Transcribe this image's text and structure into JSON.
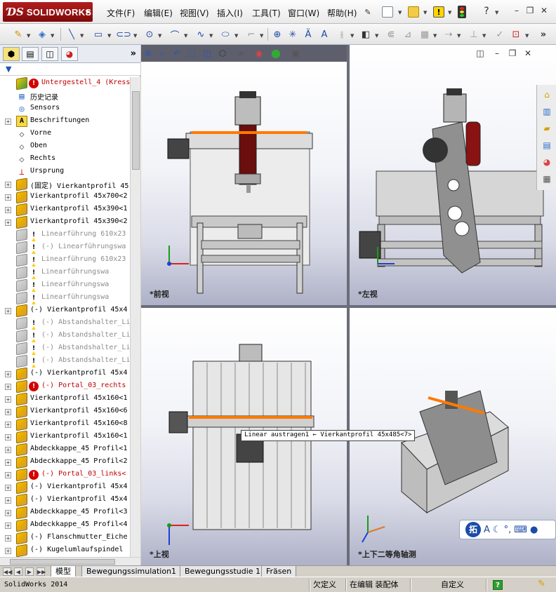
{
  "app": {
    "brand": "SOLIDWORKS"
  },
  "menu": [
    "文件(F)",
    "编辑(E)",
    "视图(V)",
    "插入(I)",
    "工具(T)",
    "窗口(W)",
    "帮助(H)"
  ],
  "tree": {
    "items": [
      {
        "label": "Untergestell_4  (Kress 1",
        "style": "red",
        "icon": "assembly",
        "exp": "",
        "badge": "error"
      },
      {
        "label": "历史记录",
        "style": "normal",
        "icon": "history",
        "exp": ""
      },
      {
        "label": "Sensors",
        "style": "normal",
        "icon": "sensor",
        "exp": ""
      },
      {
        "label": "Beschriftungen",
        "style": "normal",
        "icon": "annotation",
        "exp": "+"
      },
      {
        "label": "Vorne",
        "style": "normal",
        "icon": "plane",
        "exp": ""
      },
      {
        "label": "Oben",
        "style": "normal",
        "icon": "plane",
        "exp": ""
      },
      {
        "label": "Rechts",
        "style": "normal",
        "icon": "plane",
        "exp": ""
      },
      {
        "label": "Ursprung",
        "style": "normal",
        "icon": "origin",
        "exp": ""
      },
      {
        "label": "(固定) Vierkantprofil 45",
        "style": "normal",
        "icon": "part",
        "exp": "+"
      },
      {
        "label": "Vierkantprofil 45x700<2",
        "style": "normal",
        "icon": "part",
        "exp": "+"
      },
      {
        "label": "Vierkantprofil 45x390<1",
        "style": "normal",
        "icon": "part",
        "exp": "+"
      },
      {
        "label": "Vierkantprofil 45x390<2",
        "style": "normal",
        "icon": "part",
        "exp": "+"
      },
      {
        "label": "Linearführung 610x23",
        "style": "gray",
        "icon": "ghost",
        "exp": "",
        "badge": "warn"
      },
      {
        "label": "(-) Linearführungswa",
        "style": "gray",
        "icon": "ghost",
        "exp": "",
        "badge": "warn"
      },
      {
        "label": "Linearführung 610x23",
        "style": "gray",
        "icon": "ghost",
        "exp": "",
        "badge": "warn"
      },
      {
        "label": "Linearführungswa",
        "style": "gray",
        "icon": "ghost",
        "exp": "",
        "badge": "warn"
      },
      {
        "label": "Linearführungswa",
        "style": "gray",
        "icon": "ghost",
        "exp": "",
        "badge": "warn"
      },
      {
        "label": "Linearführungswa",
        "style": "gray",
        "icon": "ghost",
        "exp": "",
        "badge": "warn"
      },
      {
        "label": "(-) Vierkantprofil 45x4",
        "style": "normal",
        "icon": "part",
        "exp": "+"
      },
      {
        "label": "(-) Abstandshalter_Li",
        "style": "gray",
        "icon": "ghost",
        "exp": "",
        "badge": "warn"
      },
      {
        "label": "(-) Abstandshalter_Li",
        "style": "gray",
        "icon": "ghost",
        "exp": "",
        "badge": "warn"
      },
      {
        "label": "(-) Abstandshalter_Li",
        "style": "gray",
        "icon": "ghost",
        "exp": "",
        "badge": "warn"
      },
      {
        "label": "(-) Abstandshalter_Li",
        "style": "gray",
        "icon": "ghost",
        "exp": "",
        "badge": "warn"
      },
      {
        "label": "(-) Vierkantprofil 45x4",
        "style": "normal",
        "icon": "part",
        "exp": "+"
      },
      {
        "label": "(-) Portal_03_rechts",
        "style": "red",
        "icon": "part",
        "exp": "+",
        "badge": "error"
      },
      {
        "label": "Vierkantprofil 45x160<1",
        "style": "normal",
        "icon": "part",
        "exp": "+"
      },
      {
        "label": "Vierkantprofil 45x160<6",
        "style": "normal",
        "icon": "part",
        "exp": "+"
      },
      {
        "label": "Vierkantprofil 45x160<8",
        "style": "normal",
        "icon": "part",
        "exp": "+"
      },
      {
        "label": "Vierkantprofil 45x160<1",
        "style": "normal",
        "icon": "part",
        "exp": "+"
      },
      {
        "label": "Abdeckkappe_45 Profil<1",
        "style": "normal",
        "icon": "part",
        "exp": "+"
      },
      {
        "label": "Abdeckkappe_45 Profil<2",
        "style": "normal",
        "icon": "part",
        "exp": "+"
      },
      {
        "label": "(-) Portal_03_links<",
        "style": "red",
        "icon": "part",
        "exp": "+",
        "badge": "error"
      },
      {
        "label": "(-) Vierkantprofil 45x4",
        "style": "normal",
        "icon": "part",
        "exp": "+"
      },
      {
        "label": "(-) Vierkantprofil 45x4",
        "style": "normal",
        "icon": "part",
        "exp": "+"
      },
      {
        "label": "Abdeckkappe_45 Profil<3",
        "style": "normal",
        "icon": "part",
        "exp": "+"
      },
      {
        "label": "Abdeckkappe_45 Profil<4",
        "style": "normal",
        "icon": "part",
        "exp": "+"
      },
      {
        "label": "(-) Flanschmutter_Eiche",
        "style": "normal",
        "icon": "part",
        "exp": "+"
      },
      {
        "label": "(-) Kugelumlaufspindel",
        "style": "normal",
        "icon": "part",
        "exp": "+"
      }
    ]
  },
  "viewports": {
    "front": "*前视",
    "left": "*左视",
    "top": "*上视",
    "iso": "*上下二等角轴测"
  },
  "tooltip": "Linear austragen1 ← Vierkantprofil 45x485<7>",
  "ime": {
    "logo": "拓"
  },
  "bottom_tabs": [
    "模型",
    "Bewegungssimulation1",
    "Bewegungsstudie 1",
    "Fräsen"
  ],
  "status": {
    "app": "SolidWorks 2014",
    "s1": "欠定义",
    "s2": "在编辑 装配体",
    "s3": "自定义",
    "help": "?"
  },
  "colors": {
    "accent_orange": "#ff7a00",
    "brand_red": "#a51616",
    "axis_x": "#e02020",
    "axis_y": "#1a9a1a",
    "axis_z": "#1f3fd8"
  }
}
